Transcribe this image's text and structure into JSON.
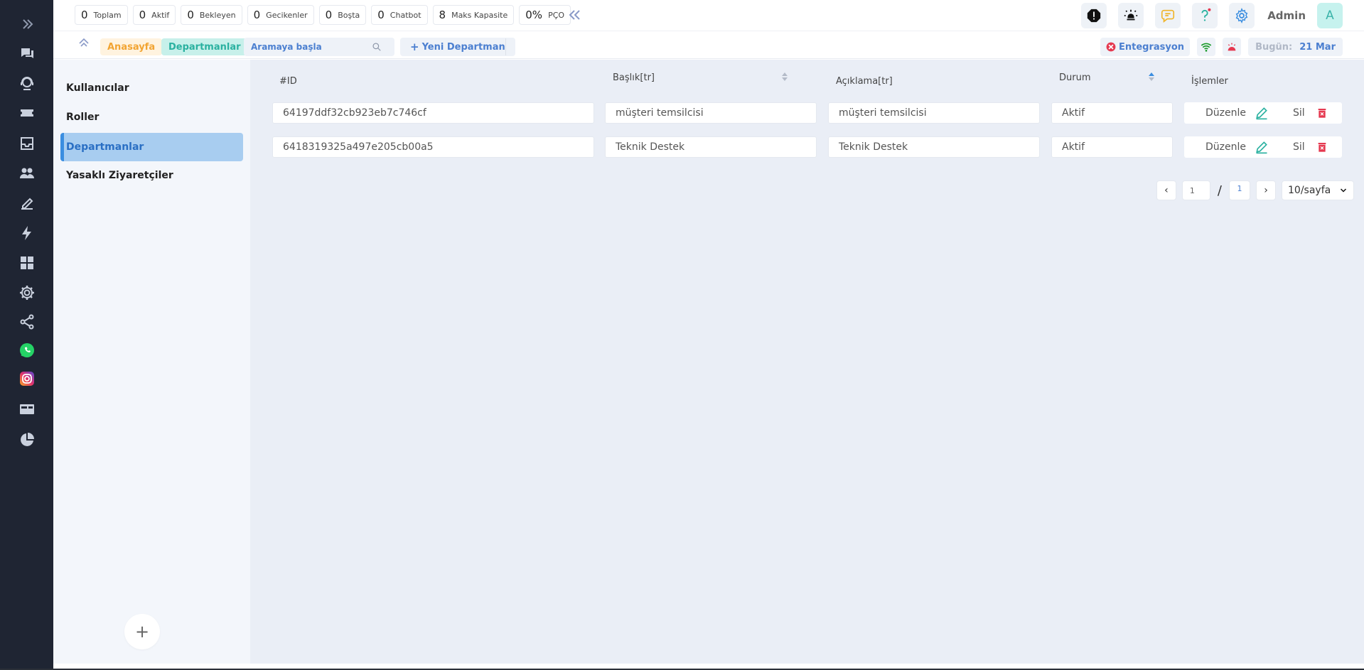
{
  "stats": [
    {
      "value": "0",
      "label": "Toplam"
    },
    {
      "value": "0",
      "label": "Aktif"
    },
    {
      "value": "0",
      "label": "Bekleyen"
    },
    {
      "value": "0",
      "label": "Gecikenler"
    },
    {
      "value": "0",
      "label": "Boşta"
    },
    {
      "value": "0",
      "label": "Chatbot"
    },
    {
      "value": "8",
      "label": "Maks Kapasite"
    },
    {
      "value": "0%",
      "label": "PÇO"
    }
  ],
  "header": {
    "collapse_glyph": "«",
    "admin_name": "Admin",
    "avatar_letter": "A"
  },
  "subbar": {
    "crumb_home": "Anasayfa",
    "crumb_current": "Departmanlar",
    "search_placeholder": "Aramaya başla",
    "new_button": "Yeni Departman",
    "integration_label": "Entegrasyon",
    "today_label": "Bugün:",
    "today_value": "21 Mar"
  },
  "sidebar": {
    "items": [
      {
        "label": "Kullanıcılar"
      },
      {
        "label": "Roller"
      },
      {
        "label": "Departmanlar",
        "active": true
      },
      {
        "label": "Yasaklı Ziyaretçiler"
      }
    ],
    "add_label": "+"
  },
  "table": {
    "headers": {
      "id": "#ID",
      "title": "Başlık[tr]",
      "desc": "Açıklama[tr]",
      "status": "Durum",
      "actions": "İşlemler"
    },
    "rows": [
      {
        "id": "64197ddf32cb923eb7c746cf",
        "title": "müşteri temsilcisi",
        "desc": "müşteri temsilcisi",
        "status": "Aktif"
      },
      {
        "id": "6418319325a497e205cb00a5",
        "title": "Teknik Destek",
        "desc": "Teknik Destek",
        "status": "Aktif"
      }
    ],
    "edit_label": "Düzenle",
    "delete_label": "Sil"
  },
  "pagination": {
    "prev": "‹",
    "next": "›",
    "current_page": "1",
    "separator": "/",
    "total_pages": "1",
    "page_size": "10/sayfa"
  },
  "colors": {
    "rail": "#1f2533",
    "accent": "#4b7fd0",
    "active_bg": "#a8cdf0",
    "teal": "#2ab1a0",
    "danger": "#e53950"
  },
  "rail_icons": [
    "expand-icon",
    "chat-bubbles-icon",
    "support-agent-icon",
    "ticket-icon",
    "inbox-icon",
    "users-icon",
    "edit-note-icon",
    "bolt-icon",
    "grid-icon",
    "settings-icon",
    "share-icon",
    "whatsapp-icon",
    "instagram-icon",
    "card-icon",
    "pie-chart-icon"
  ]
}
